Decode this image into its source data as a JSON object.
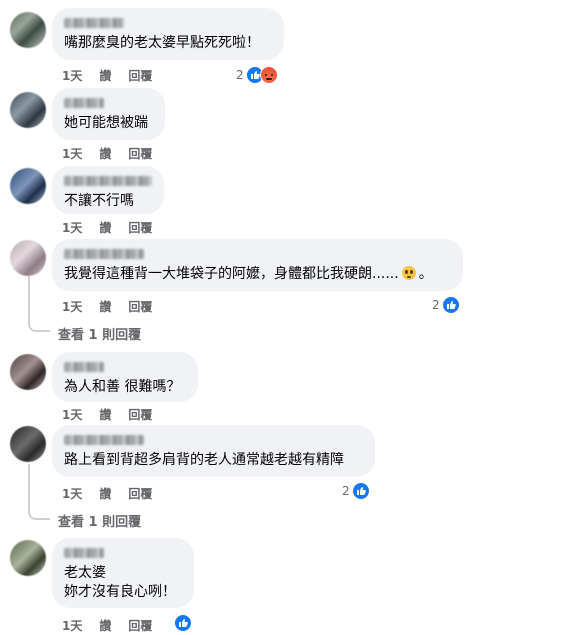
{
  "actions": {
    "time": "1天",
    "like": "讚",
    "reply": "回覆"
  },
  "view_replies": "查看 1 則回覆",
  "comments": [
    {
      "text": "嘴那麼臭的老太婆早點死死啦！",
      "reaction_count": "2",
      "reactions": [
        "like-icon",
        "angry-icon"
      ]
    },
    {
      "text": "她可能想被踹"
    },
    {
      "text": "不讓不行嗎"
    },
    {
      "text": "我覺得這種背一大堆袋子的阿嬤，身體都比我硬朗......",
      "text_tail": "。",
      "emoji": "pleading-face-icon",
      "reaction_count": "2",
      "reactions": [
        "like-icon"
      ]
    },
    {
      "text": "為人和善 很難嗎？"
    },
    {
      "text": "路上看到背超多肩背的老人通常越老越有精障",
      "reaction_count": "2",
      "reactions": [
        "like-icon"
      ]
    },
    {
      "text": "老太婆\n妳才沒有良心咧！",
      "reactions": [
        "like-icon"
      ]
    }
  ]
}
